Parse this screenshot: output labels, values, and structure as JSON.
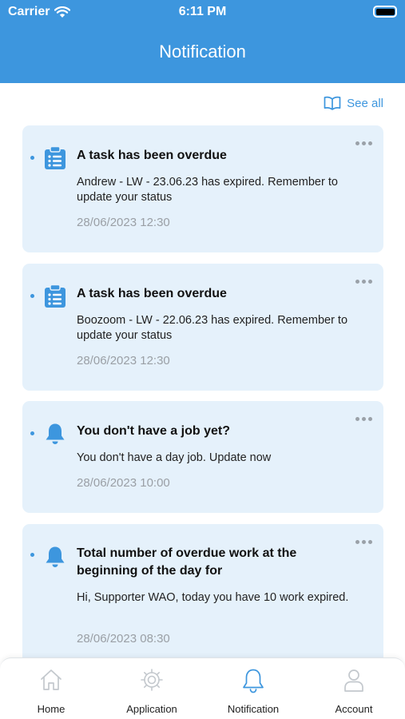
{
  "status_bar": {
    "carrier": "Carrier",
    "time": "6:11 PM"
  },
  "header": {
    "title": "Notification"
  },
  "see_all": {
    "label": "See all"
  },
  "notifications": [
    {
      "icon": "clipboard-list-icon",
      "title": "A task has been overdue",
      "body": "Andrew - LW - 23.06.23 has expired. Remember to update your status",
      "date": "28/06/2023 12:30"
    },
    {
      "icon": "clipboard-list-icon",
      "title": "A task has been overdue",
      "body": "Boozoom - LW - 22.06.23 has expired. Remember to update your status",
      "date": "28/06/2023 12:30"
    },
    {
      "icon": "bell-icon",
      "title": "You don't have a job yet?",
      "body": "You don't have a day job. Update now",
      "date": "28/06/2023 10:00"
    },
    {
      "icon": "bell-icon",
      "title": "Total number of overdue work at the beginning of the day for",
      "body": "Hi, Supporter WAO, today you have 10 work expired.",
      "date": "28/06/2023 08:30"
    }
  ],
  "tabbar": {
    "items": [
      {
        "label": "Home",
        "icon": "home-icon"
      },
      {
        "label": "Application",
        "icon": "gear-icon"
      },
      {
        "label": "Notification",
        "icon": "bell-icon",
        "active": true
      },
      {
        "label": "Account",
        "icon": "person-icon"
      }
    ]
  },
  "colors": {
    "accent": "#3d96de",
    "card_bg": "#e5f1fb",
    "muted": "#9a9fa5",
    "inactive_icon": "#c3c8cd"
  }
}
